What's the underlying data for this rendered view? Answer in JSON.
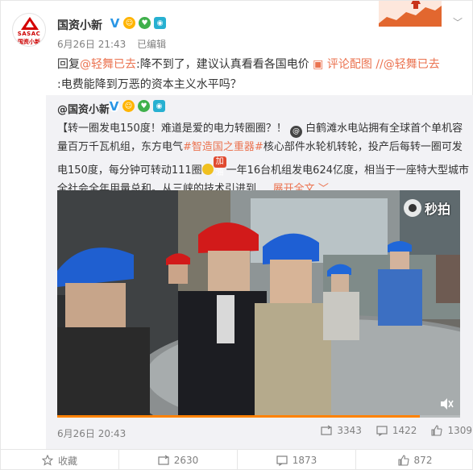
{
  "post": {
    "author": "国资小新",
    "avatar_line1": "SASAC",
    "avatar_line2": "国资小新",
    "date": "6月26日 21:43",
    "edited": "已编辑",
    "text_prefix": "回复",
    "reply_user": "@轻舞已去",
    "text_body": ":降不到了，建议认真看看各国电价",
    "comment_pic_label": "评论配图",
    "repost_chain": "//@轻舞已去",
    "text_line2": ":电费能降到万恶的资本主义水平吗？"
  },
  "quote": {
    "author": "@国资小新",
    "text_part1": "【转一圈发电150度！难道是爱的电力转圈圈？！",
    "text_part2": "白鹤滩水电站拥有全球首个单机容量百万千瓦机组，东方电气",
    "hashtag": "#智造国之重器#",
    "text_part3": "核心部件水轮机转轮，投产后每转一圈可发电150度，每分钟可转动111圈",
    "emo_label": "加油",
    "text_part4": "一年16台机组发电624亿度，相当于一座特大型城市全社会全年用量总和。从三峡的技术引进到 ...",
    "expand": "展开全文",
    "video_brand": "秒拍",
    "video_progress": 0.9,
    "date": "6月26日 20:43",
    "stats": {
      "reposts": "3343",
      "comments": "1422",
      "likes": "1309"
    }
  },
  "actions": {
    "favorite": "收藏",
    "repost": "2630",
    "comment": "1873",
    "like": "872"
  },
  "colors": {
    "link": "#eb7350",
    "muted": "#808080",
    "quote_bg": "#f2f2f5",
    "progress": "#ff8200"
  }
}
